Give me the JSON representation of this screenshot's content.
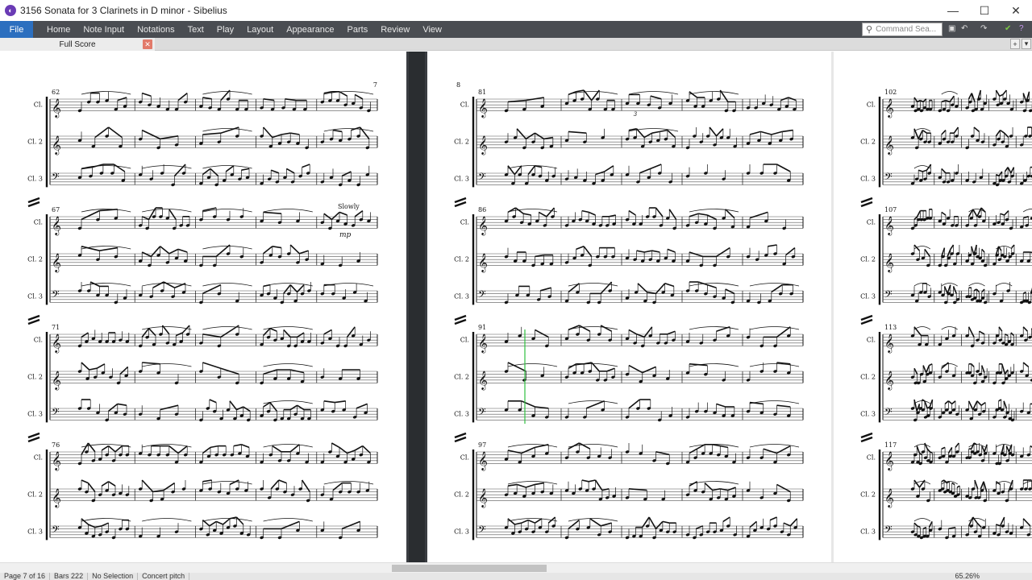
{
  "window": {
    "title": "3156 Sonata for 3 Clarinets in D minor - Sibelius"
  },
  "ribbon": {
    "file": "File",
    "tabs": [
      "Home",
      "Note Input",
      "Notations",
      "Text",
      "Play",
      "Layout",
      "Appearance",
      "Parts",
      "Review",
      "View"
    ],
    "command_search_placeholder": "Command Sea..."
  },
  "doc_tab": {
    "label": "Full Score"
  },
  "score": {
    "page_numbers": [
      "7",
      "8"
    ],
    "instruments": [
      "Cl.",
      "Cl. 2",
      "Cl. 3"
    ],
    "page1_measures": [
      "62",
      "67",
      "71",
      "76"
    ],
    "page2_measures": [
      "81",
      "86",
      "91",
      "97"
    ],
    "page3_measures": [
      "102",
      "107",
      "113",
      "117"
    ],
    "tempo_text": "Slowly",
    "dynamic_text": "mp",
    "triplet_mark": "3"
  },
  "status": {
    "items": [
      "Page 7 of 16",
      "Bars 222",
      "No Selection",
      "Concert pitch"
    ],
    "zoom": "65.26%"
  }
}
